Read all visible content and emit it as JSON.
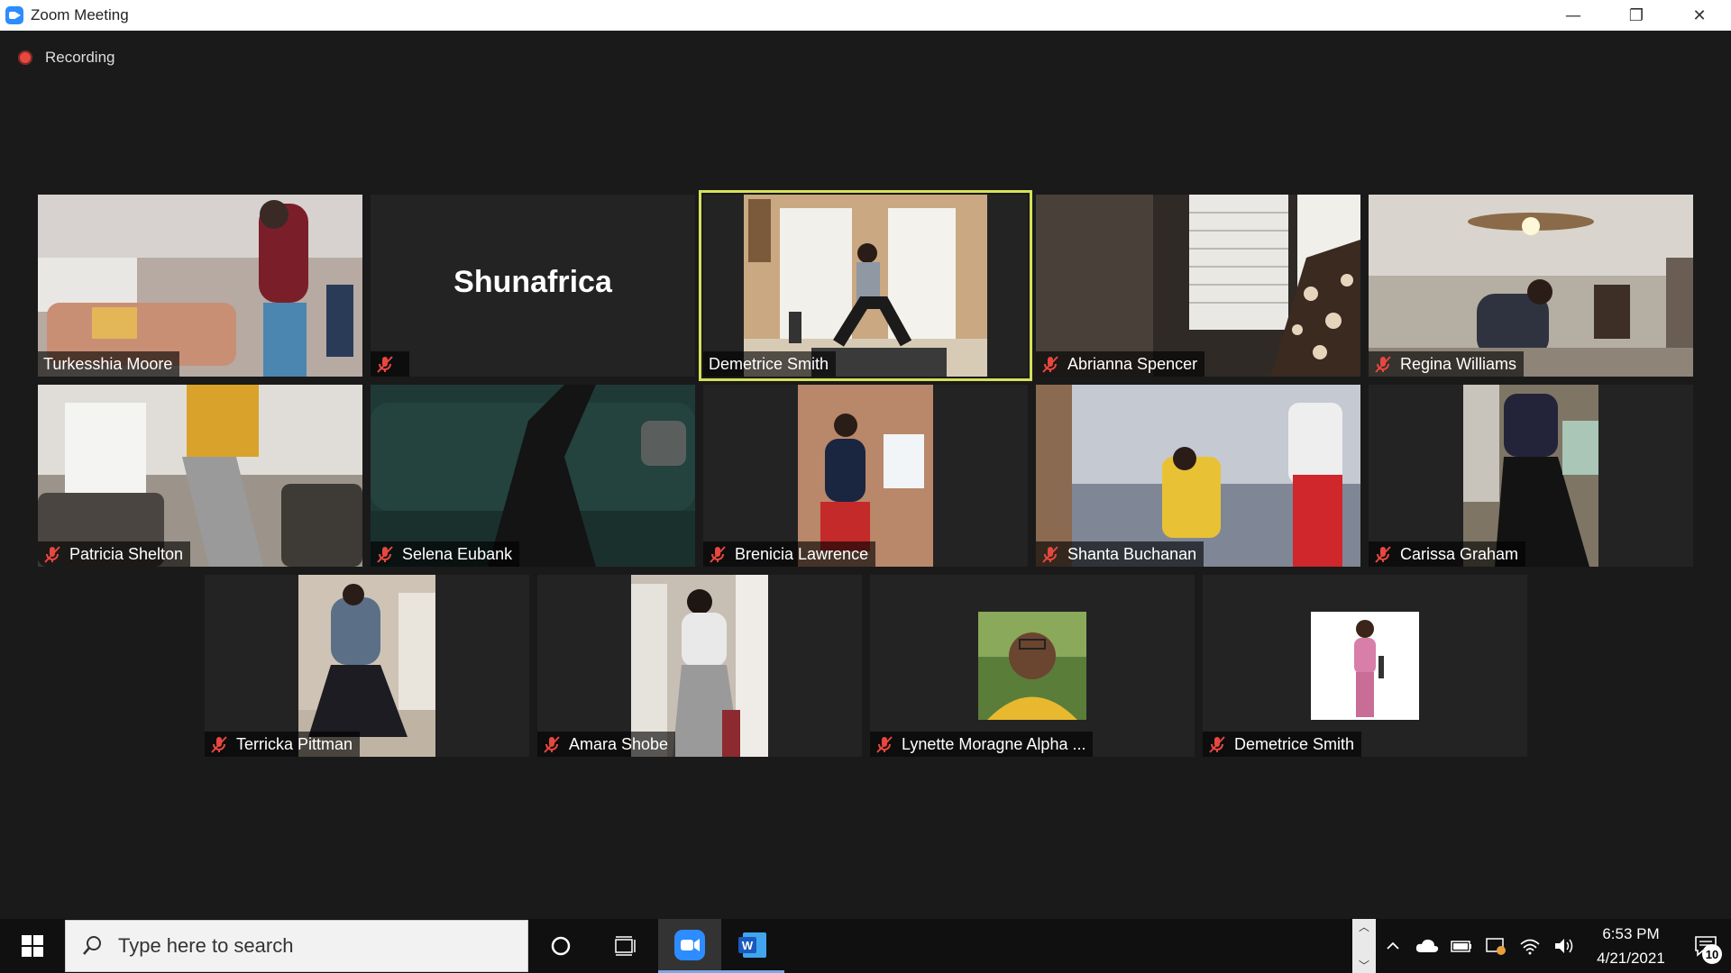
{
  "window": {
    "title": "Zoom Meeting",
    "minimize_glyph": "—",
    "restore_glyph": "❐",
    "close_glyph": "✕"
  },
  "recording": {
    "label": "Recording"
  },
  "participants": [
    {
      "name": "Turkesshia Moore",
      "muted": false,
      "video": true
    },
    {
      "name": "Shunafrica",
      "muted": true,
      "video": false
    },
    {
      "name": "Demetrice Smith",
      "muted": false,
      "video": true,
      "active_speaker": true
    },
    {
      "name": "Abrianna Spencer",
      "muted": true,
      "video": true
    },
    {
      "name": "Regina Williams",
      "muted": true,
      "video": true
    },
    {
      "name": "Patricia Shelton",
      "muted": true,
      "video": true
    },
    {
      "name": "Selena Eubank",
      "muted": true,
      "video": true
    },
    {
      "name": "Brenicia Lawrence",
      "muted": true,
      "video": true
    },
    {
      "name": "Shanta Buchanan",
      "muted": true,
      "video": true
    },
    {
      "name": "Carissa Graham",
      "muted": true,
      "video": true
    },
    {
      "name": "Terricka Pittman",
      "muted": true,
      "video": true
    },
    {
      "name": "Amara Shobe",
      "muted": true,
      "video": true
    },
    {
      "name": "Lynette Moragne Alpha ...",
      "muted": true,
      "video": false,
      "profile_picture": true
    },
    {
      "name": "Demetrice Smith",
      "muted": true,
      "video": false,
      "profile_picture": true
    }
  ],
  "taskbar": {
    "search_placeholder": "Type here to search",
    "time": "6:53 PM",
    "date": "4/21/2021",
    "notification_count": "10"
  },
  "colors": {
    "active_speaker_border": "#d6e05a",
    "mute_icon": "#e8473f",
    "zoom_blue": "#2d8cff"
  }
}
